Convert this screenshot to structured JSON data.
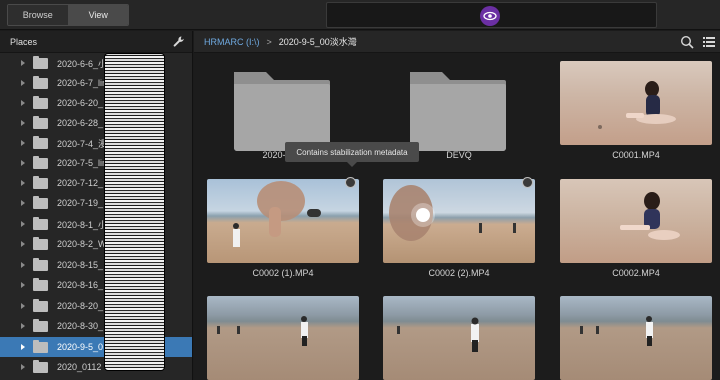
{
  "topbar": {
    "browse_label": "Browse",
    "view_label": "View"
  },
  "sidebar": {
    "title": "Places",
    "items": [
      {
        "label": "2020-6-6_小"
      },
      {
        "label": "2020-6-7_lin"
      },
      {
        "label": "2020-6-20_"
      },
      {
        "label": "2020-6-28_"
      },
      {
        "label": "2020-7-4_漫"
      },
      {
        "label": "2020-7-5_lin"
      },
      {
        "label": "2020-7-12_"
      },
      {
        "label": "2020-7-19_"
      },
      {
        "label": "2020-8-1_小"
      },
      {
        "label": "2020-8-2_W"
      },
      {
        "label": "2020-8-15_"
      },
      {
        "label": "2020-8-16_"
      },
      {
        "label": "2020-8-20_"
      },
      {
        "label": "2020-8-30_"
      },
      {
        "label": "2020-9-5_0"
      },
      {
        "label": "2020_0112"
      }
    ],
    "selected_index": 14
  },
  "pathbar": {
    "root": "HRMARC (I:\\)",
    "separator": ">",
    "current": "2020-9-5_00淡水灣"
  },
  "tooltip": "Contains stabilization metadata",
  "tiles": [
    {
      "caption": "2020-9-5_",
      "kind": "folder"
    },
    {
      "caption": "DEVQ",
      "kind": "folder"
    },
    {
      "caption": "C0001.MP4",
      "kind": "video"
    },
    {
      "caption": "C0002 (1).MP4",
      "kind": "video",
      "stabilized": true
    },
    {
      "caption": "C0002 (2).MP4",
      "kind": "video",
      "stabilized": true
    },
    {
      "caption": "C0002.MP4",
      "kind": "video"
    },
    {
      "caption": "",
      "kind": "video"
    },
    {
      "caption": "",
      "kind": "video"
    },
    {
      "caption": "",
      "kind": "video"
    }
  ],
  "colors": {
    "accent_selected": "#3b79b5",
    "path_root": "#6fa9e0",
    "app_logo": "#6b2fa3"
  }
}
